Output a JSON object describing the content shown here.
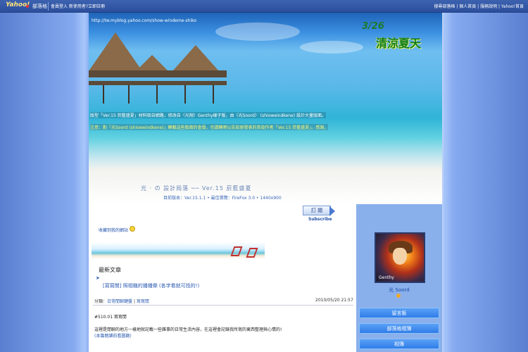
{
  "topbar": {
    "logo": "Yahoo!",
    "blog": "部落格",
    "links": "會員登入  新使用者?立即註冊",
    "right_links": "搜尋部落格 | 個人首頁 | 服務說明 | Yahoo!首頁"
  },
  "banner": {
    "url": "http://tw.myblog.yahoo.com/show-windeme-shiko",
    "date": "3/26",
    "slogan": "清涼夏天",
    "line1": "版型「Ver.15 菸藍盛夏」材料取自網路，修改自〈光翔〉Genthy樣子版，由〈光Soord〉 (shioweindkene) 設計大量版面。",
    "line2": "注意：對「光Soord (shioweindkene)」轉載這些版面的會員，也請轉寄以告知原發表的首頁作者「Ver.15 菸藍盛夏」。感謝。",
    "title": "光 · の 設計局落 ── Ver.15 菸藍盛夏",
    "meta": "目前版本：Ver.15.1.1 • 最佳瀏覽：FireFox 3.0 • 1440x900"
  },
  "content": {
    "subscribe_button": "訂 閱",
    "subscribe_label": "Subscribe",
    "fav_link": "收藏到我的網站",
    "section_title": "最新文章",
    "post_title_tag": "[寫寫閒]",
    "post_title": "照相機的播播樂 (各字看就可找的!)",
    "category_prefix": "分類：",
    "category": "日常閒聊鍵盤",
    "category_sep": " | ",
    "category2": "寫寫閒",
    "post_date": "2010/05/20 21:57",
    "post_head": "#510.01 寫寫閒",
    "post_body": "這裡是閒聊的地方一樣地就記載一些雜事的日常生活內容，在這裡會記錄我所寫的東西整理與心情的!",
    "post_more": "(本篇閱讀前看圖籍)"
  },
  "sidebar": {
    "avatar_caption": "Genthy",
    "author": "光 Soord",
    "buttons": [
      "留言板",
      "部落格相簿",
      "相簿"
    ]
  }
}
